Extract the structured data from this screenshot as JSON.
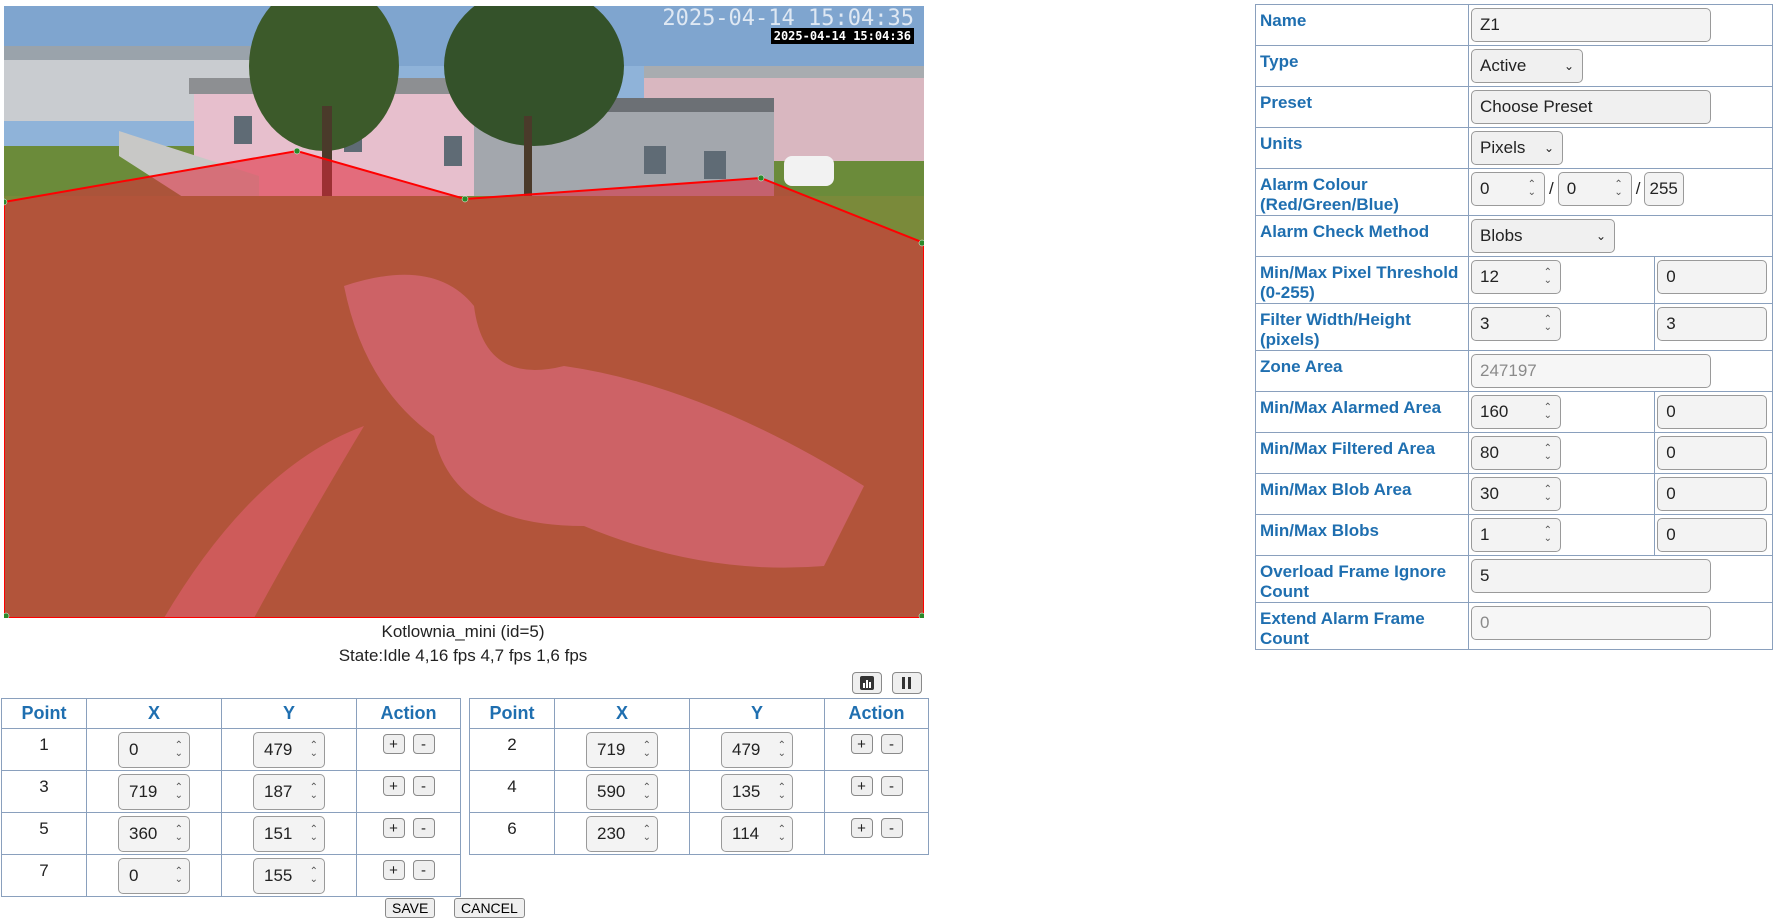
{
  "camera": {
    "timestamp_overlay": "2025-04-14 15:04:35",
    "timestamp_small": "2025-04-14 15:04:36",
    "monitor_name": "Kotlownia_mini (id=5)",
    "state": "State:Idle 4,16 fps 4,7 fps 1,6 fps",
    "zone_fill_color": "#e0283a",
    "zone_line_color": "#ff0000"
  },
  "controls": {
    "stats_icon": "bar-chart-icon",
    "pause_icon": "pause-icon"
  },
  "points_table": {
    "headers": [
      "Point",
      "X",
      "Y",
      "Action"
    ],
    "left_rows": [
      {
        "point": "1",
        "x": "0",
        "y": "479"
      },
      {
        "point": "3",
        "x": "719",
        "y": "187"
      },
      {
        "point": "5",
        "x": "360",
        "y": "151"
      },
      {
        "point": "7",
        "x": "0",
        "y": "155"
      }
    ],
    "right_rows": [
      {
        "point": "2",
        "x": "719",
        "y": "479"
      },
      {
        "point": "4",
        "x": "590",
        "y": "135"
      },
      {
        "point": "6",
        "x": "230",
        "y": "114"
      }
    ],
    "add_label": "+",
    "remove_label": "-",
    "save_label": "SAVE",
    "cancel_label": "CANCEL"
  },
  "settings": {
    "name": {
      "label": "Name",
      "value": "Z1"
    },
    "type": {
      "label": "Type",
      "value": "Active"
    },
    "preset": {
      "label": "Preset",
      "value": "Choose Preset"
    },
    "units": {
      "label": "Units",
      "value": "Pixels"
    },
    "alarm_colour": {
      "label": "Alarm Colour (Red/Green/Blue)",
      "red": "0",
      "green": "0",
      "blue": "255"
    },
    "check_method": {
      "label": "Alarm Check Method",
      "value": "Blobs"
    },
    "pixel_threshold": {
      "label": "Min/Max Pixel Threshold (0-255)",
      "min": "12",
      "max": "0"
    },
    "filter": {
      "label": "Filter Width/Height (pixels)",
      "width": "3",
      "height": "3"
    },
    "zone_area": {
      "label": "Zone Area",
      "value": "247197"
    },
    "alarmed_area": {
      "label": "Min/Max Alarmed Area",
      "min": "160",
      "max": "0"
    },
    "filtered_area": {
      "label": "Min/Max Filtered Area",
      "min": "80",
      "max": "0"
    },
    "blob_area": {
      "label": "Min/Max Blob Area",
      "min": "30",
      "max": "0"
    },
    "blobs": {
      "label": "Min/Max Blobs",
      "min": "1",
      "max": "0"
    },
    "overload": {
      "label": "Overload Frame Ignore Count",
      "value": "5"
    },
    "extend": {
      "label": "Extend Alarm Frame Count",
      "value": "0"
    }
  }
}
